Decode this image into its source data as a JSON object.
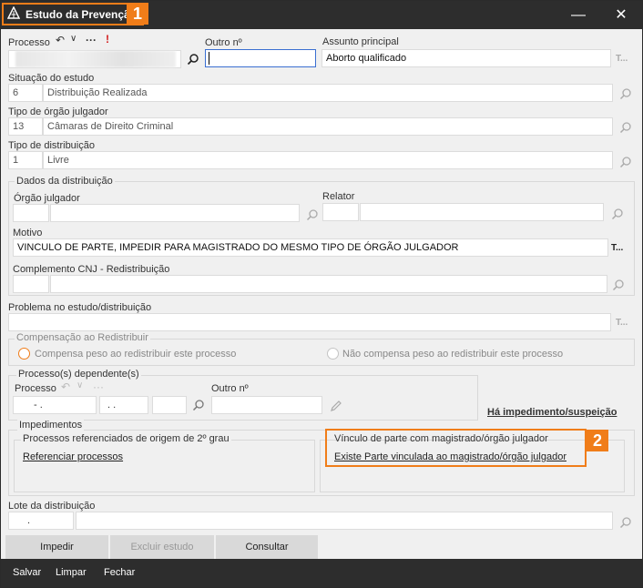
{
  "window": {
    "title": "Estudo da Prevenção",
    "callout1": "1",
    "minimize_glyph": "—",
    "close_glyph": "✕"
  },
  "colors": {
    "accent": "#f07d19",
    "titlebar": "#2d2d2d"
  },
  "header": {
    "processo_label": "Processo",
    "undo_glyph": "↶",
    "chevron_glyph": "∨",
    "more_glyph": "···",
    "alert_glyph": "!",
    "outro_label": "Outro nº",
    "outro_value": "",
    "assunto_label": "Assunto principal",
    "assunto_value": "Aborto qualificado"
  },
  "situacao": {
    "label": "Situação do estudo",
    "code": "6",
    "value": "Distribuição Realizada"
  },
  "tipo_orgao": {
    "label": "Tipo de órgão julgador",
    "code": "13",
    "value": "Câmaras de Direito Criminal"
  },
  "tipo_dist": {
    "label": "Tipo de distribuição",
    "code": "1",
    "value": "Livre"
  },
  "dados": {
    "group_label": "Dados da distribuição",
    "orgao_label": "Órgão julgador",
    "relator_label": "Relator",
    "motivo_label": "Motivo",
    "motivo_value": "VINCULO DE PARTE, IMPEDIR PARA MAGISTRADO DO MESMO TIPO DE ÓRGÃO JULGADOR",
    "complemento_label": "Complemento CNJ - Redistribuição"
  },
  "problema_label": "Problema no estudo/distribuição",
  "compensacao": {
    "group_label": "Compensação ao Redistribuir",
    "opt1": "Compensa peso ao redistribuir este processo",
    "opt2": "Não compensa peso ao redistribuir este processo"
  },
  "dependentes": {
    "group_label": "Processo(s) dependente(s)",
    "processo_label": "Processo",
    "outro_label": "Outro nº",
    "mask1": "-  .",
    "mask2": ".  .",
    "impedimento_link": "Há impedimento/suspeição"
  },
  "impedimentos": {
    "group_label": "Impedimentos",
    "ref_group": "Processos referenciados de origem de 2º grau",
    "ref_link": "Referenciar processos",
    "vinc_group": "Vínculo de parte com magistrado/órgão julgador",
    "vinc_link": "Existe Parte vinculada ao magistrado/órgão julgador",
    "callout2": "2"
  },
  "lote": {
    "label": "Lote da distribuição",
    "mask": "."
  },
  "actions": {
    "impedir": "Impedir",
    "excluir": "Excluir estudo",
    "consultar": "Consultar"
  },
  "bottom": {
    "salvar": "Salvar",
    "limpar": "Limpar",
    "fechar": "Fechar"
  },
  "tdots": "T..."
}
